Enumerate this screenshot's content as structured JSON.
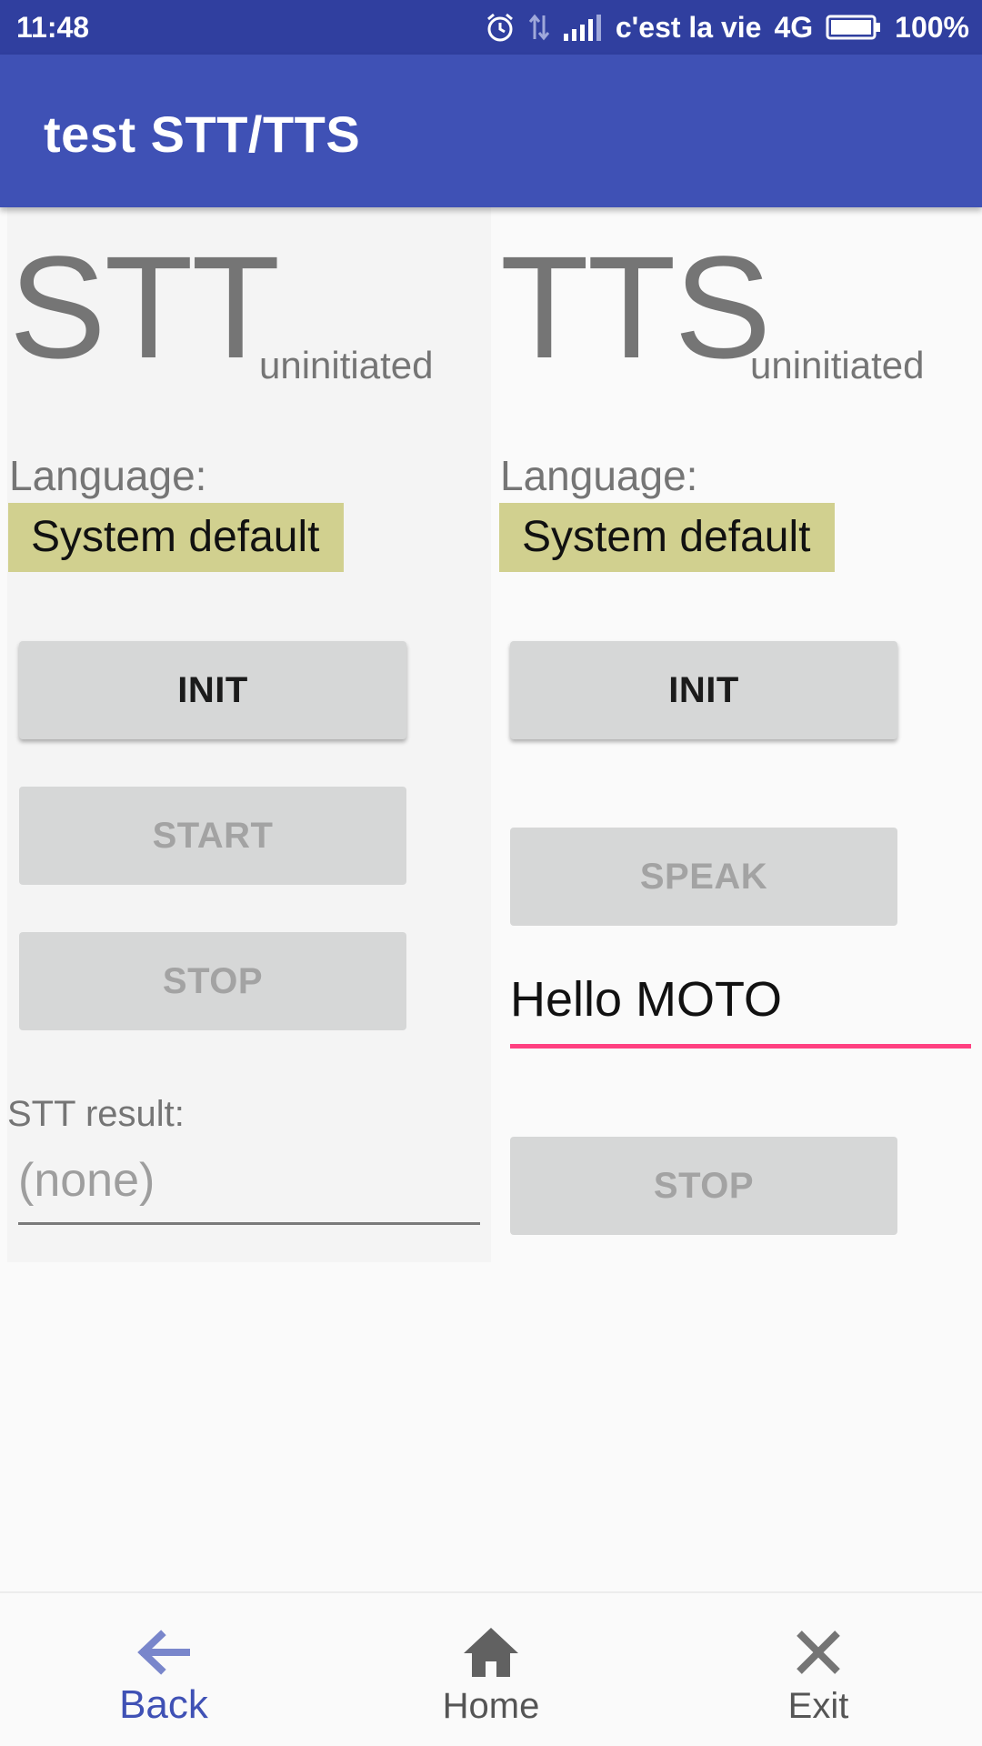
{
  "status_bar": {
    "time": "11:48",
    "carrier": "c'est la vie",
    "network": "4G",
    "battery": "100%",
    "icons": [
      "alarm-icon",
      "data-transfer-icon",
      "signal-icon",
      "battery-icon"
    ]
  },
  "app_bar": {
    "title": "test STT/TTS"
  },
  "stt": {
    "title": "STT",
    "state": "uninitiated",
    "language_label": "Language:",
    "language_value": "System default",
    "init_label": "INIT",
    "start_label": "START",
    "stop_label": "STOP",
    "result_label": "STT result:",
    "result_placeholder": "(none)"
  },
  "tts": {
    "title": "TTS",
    "state": "uninitiated",
    "language_label": "Language:",
    "language_value": "System default",
    "init_label": "INIT",
    "speak_label": "SPEAK",
    "text_value": "Hello MOTO",
    "stop_label": "STOP"
  },
  "bottom_nav": {
    "back": {
      "label": "Back",
      "icon": "arrow-left-icon"
    },
    "home": {
      "label": "Home",
      "icon": "home-icon"
    },
    "exit": {
      "label": "Exit",
      "icon": "close-icon"
    }
  },
  "colors": {
    "status_bar": "#303f9f",
    "primary": "#3f51b5",
    "accent": "#ff4081",
    "language_chip": "#d1d08f",
    "button": "#d6d7d7"
  }
}
